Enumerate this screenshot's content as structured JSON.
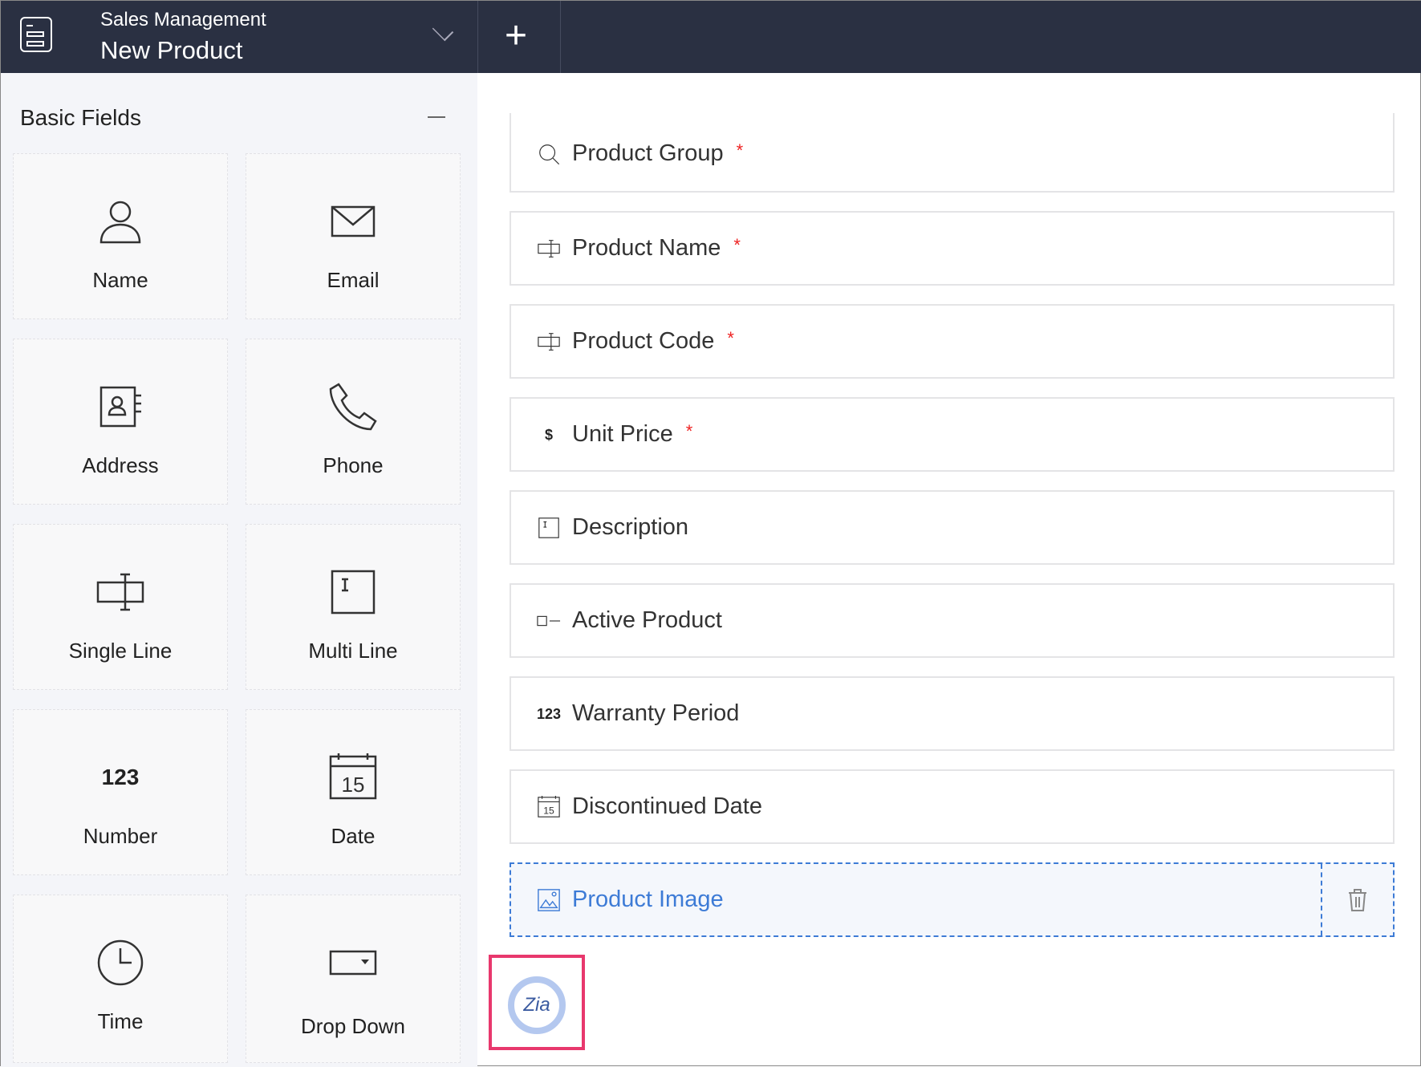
{
  "header": {
    "subtitle": "Sales Management",
    "title": "New Product"
  },
  "sidebar": {
    "title": "Basic Fields",
    "tiles": [
      {
        "label": "Name",
        "icon": "person-icon"
      },
      {
        "label": "Email",
        "icon": "envelope-icon"
      },
      {
        "label": "Address",
        "icon": "address-book-icon"
      },
      {
        "label": "Phone",
        "icon": "phone-icon"
      },
      {
        "label": "Single Line",
        "icon": "single-line-icon"
      },
      {
        "label": "Multi Line",
        "icon": "multi-line-icon"
      },
      {
        "label": "Number",
        "icon": "number-icon",
        "glyph": "123"
      },
      {
        "label": "Date",
        "icon": "calendar-icon",
        "glyph": "15"
      },
      {
        "label": "Time",
        "icon": "clock-icon"
      },
      {
        "label": "Drop Down",
        "icon": "dropdown-icon"
      }
    ]
  },
  "form": {
    "fields": [
      {
        "label": "Product Group",
        "required": "*",
        "icon": "search-icon"
      },
      {
        "label": "Product Name",
        "required": "*",
        "icon": "single-line-icon"
      },
      {
        "label": "Product Code",
        "required": "*",
        "icon": "single-line-icon"
      },
      {
        "label": "Unit Price",
        "required": "*",
        "icon": "dollar-icon",
        "glyph": "$"
      },
      {
        "label": "Description",
        "required": "",
        "icon": "multi-line-icon"
      },
      {
        "label": "Active Product",
        "required": "",
        "icon": "checkbox-icon"
      },
      {
        "label": "Warranty Period",
        "required": "",
        "icon": "number-icon",
        "glyph": "123"
      },
      {
        "label": "Discontinued Date",
        "required": "",
        "icon": "calendar-icon",
        "glyph": "15"
      },
      {
        "label": "Product Image",
        "required": "",
        "icon": "image-icon"
      }
    ]
  },
  "zia": {
    "label": "Zia"
  },
  "colors": {
    "header": "#2a3042",
    "accent": "#3d7bd6",
    "highlight": "#e8386d",
    "required": "#e22222"
  }
}
